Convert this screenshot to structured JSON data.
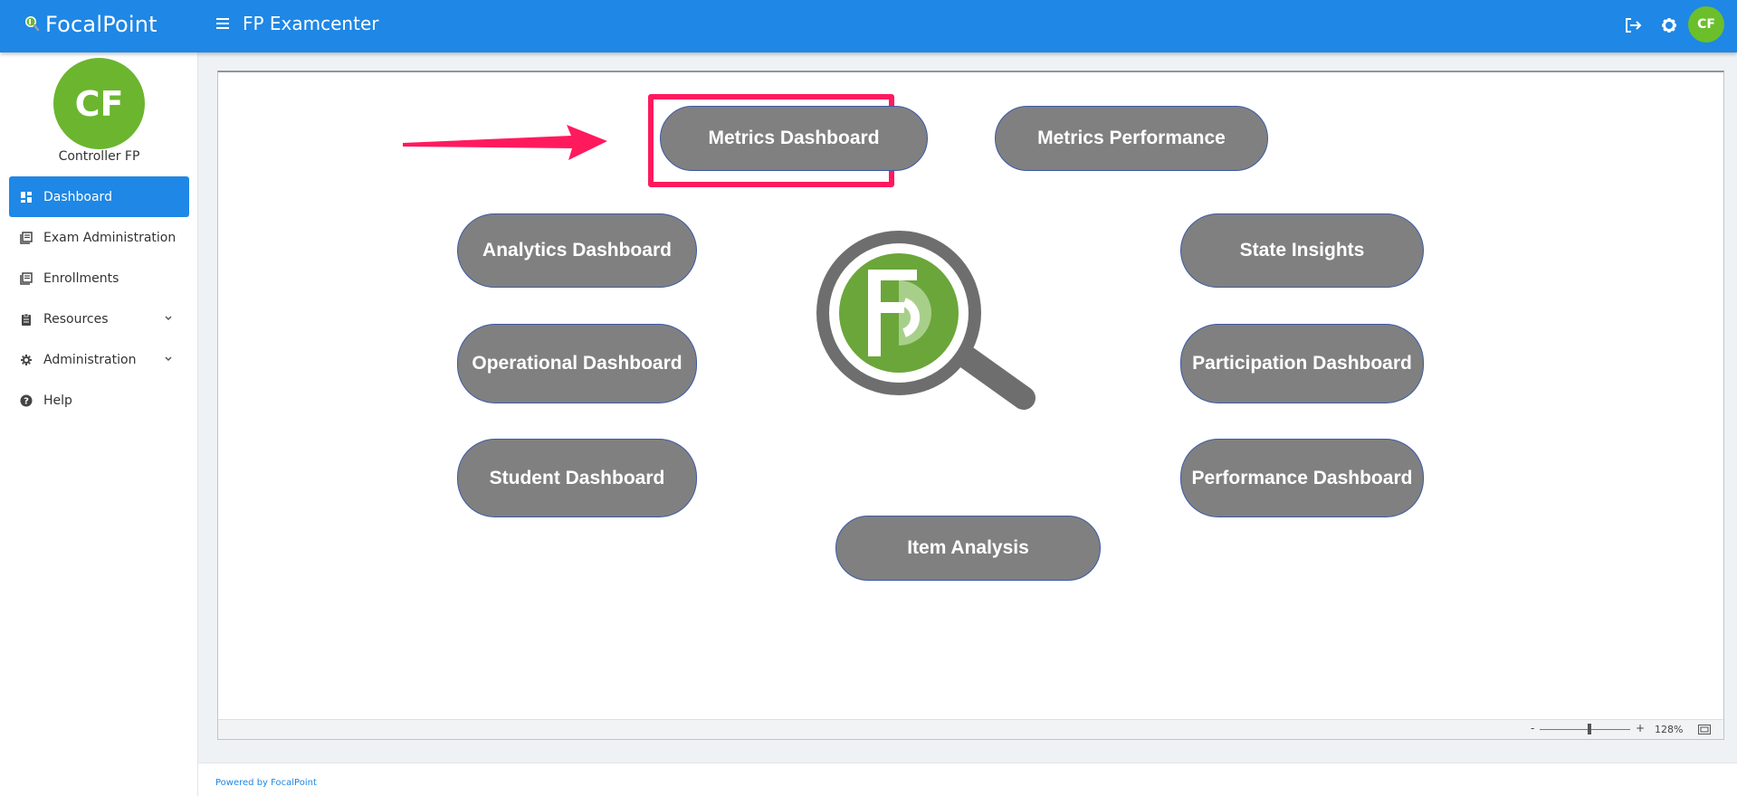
{
  "brand": {
    "name": "FocalPoint"
  },
  "header": {
    "title": "FP Examcenter",
    "avatar_initials": "CF"
  },
  "user": {
    "initials": "CF",
    "name": "Controller FP"
  },
  "sidebar": {
    "items": [
      {
        "label": "Dashboard",
        "icon": "dashboard-icon",
        "active": true
      },
      {
        "label": "Exam Administration",
        "icon": "list-icon"
      },
      {
        "label": "Enrollments",
        "icon": "list-icon"
      },
      {
        "label": "Resources",
        "icon": "clipboard-icon",
        "expandable": true
      },
      {
        "label": "Administration",
        "icon": "gear-icon",
        "expandable": true
      },
      {
        "label": "Help",
        "icon": "help-icon"
      }
    ]
  },
  "dashboard": {
    "metrics_dashboard": "Metrics Dashboard",
    "metrics_performance": "Metrics Performance",
    "analytics_dashboard": "Analytics Dashboard",
    "state_insights": "State Insights",
    "operational_dashboard": "Operational Dashboard",
    "participation_dashboard": "Participation Dashboard",
    "student_dashboard": "Student Dashboard",
    "performance_dashboard": "Performance Dashboard",
    "item_analysis": "Item Analysis"
  },
  "statusbar": {
    "zoom_minus": "-",
    "zoom_plus": "+",
    "zoom": "128%"
  },
  "footer": {
    "text": "Powered by FocalPoint"
  },
  "colors": {
    "primary": "#1f87e5",
    "avatar": "#6bb52f",
    "highlight": "#ff1a5e",
    "button": "#808080"
  }
}
